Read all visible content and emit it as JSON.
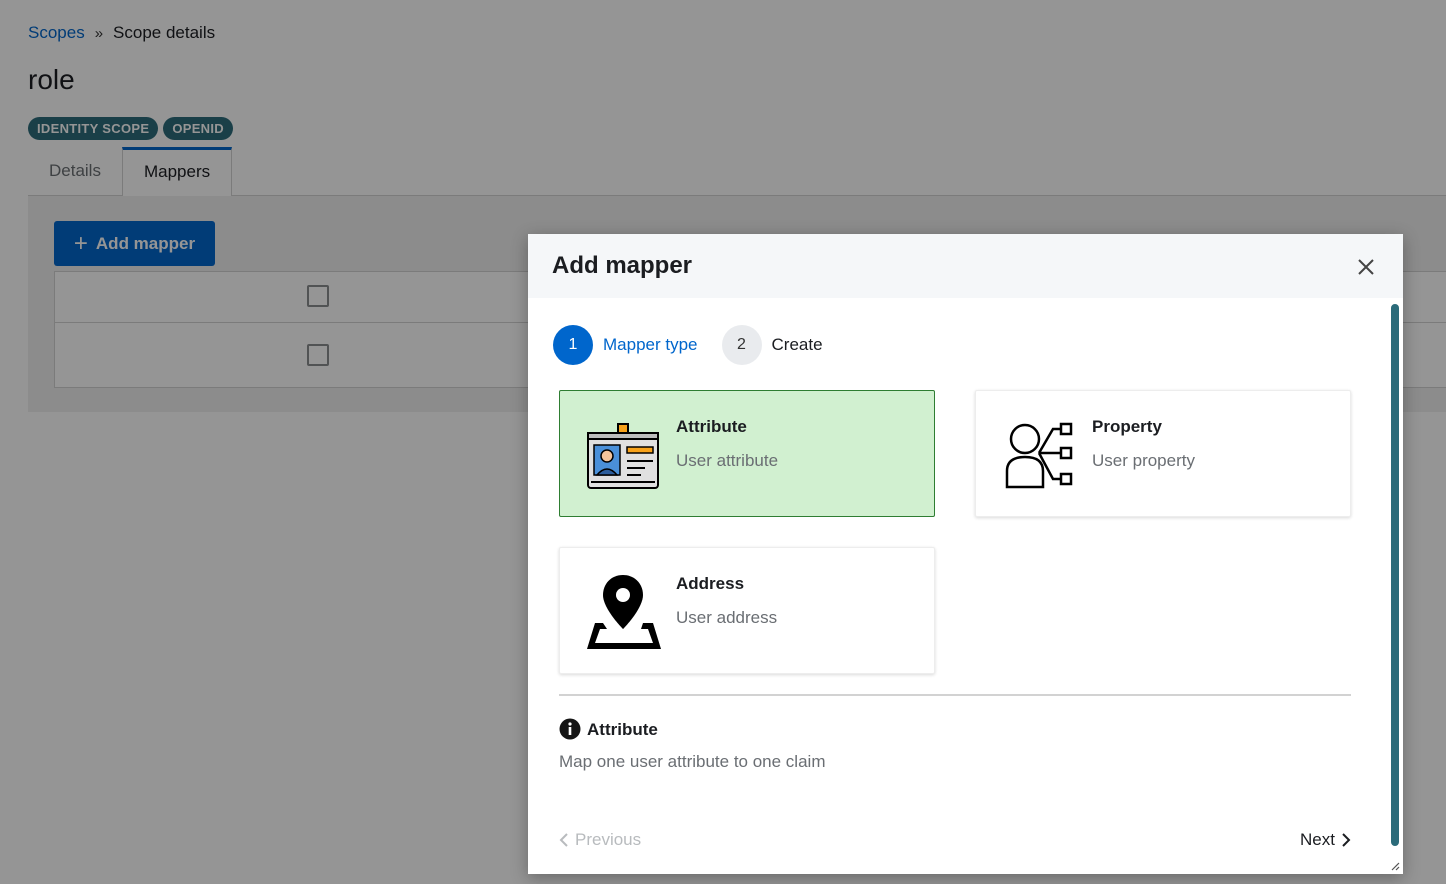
{
  "breadcrumb": {
    "parent": "Scopes",
    "separator": "»",
    "current": "Scope details"
  },
  "page": {
    "title": "role"
  },
  "badges": [
    "IDENTITY SCOPE",
    "OPENID"
  ],
  "tabs": [
    {
      "label": "Details",
      "active": false
    },
    {
      "label": "Mappers",
      "active": true
    }
  ],
  "toolbar": {
    "add_mapper_label": "Add mapper"
  },
  "modal": {
    "title": "Add mapper",
    "close_icon": "close-icon",
    "steps": [
      {
        "number": "1",
        "label": "Mapper type",
        "state": "current"
      },
      {
        "number": "2",
        "label": "Create",
        "state": "pending"
      }
    ],
    "cards": [
      {
        "title": "Attribute",
        "description": "User attribute",
        "icon": "id-card-icon",
        "selected": true
      },
      {
        "title": "Property",
        "description": "User property",
        "icon": "user-tree-icon",
        "selected": false
      },
      {
        "title": "Address",
        "description": "User address",
        "icon": "map-pin-icon",
        "selected": false
      }
    ],
    "info": {
      "icon": "info-icon",
      "title": "Attribute",
      "description": "Map one user attribute to one claim"
    },
    "footer": {
      "previous_label": "Previous",
      "next_label": "Next"
    }
  },
  "colors": {
    "primary": "#0066cc",
    "badge": "#2b6b7a",
    "selected_card_bg": "#d1f0d0",
    "selected_card_border": "#2e7d32"
  }
}
